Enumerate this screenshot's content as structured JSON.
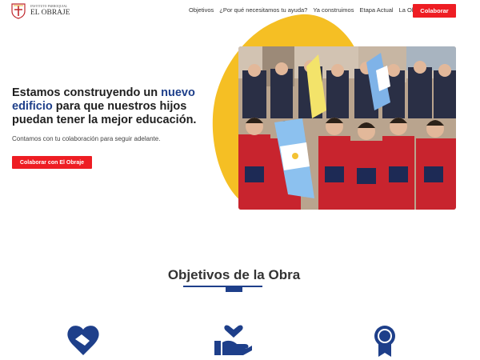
{
  "header": {
    "logo": {
      "small_text": "INSTITUTO PARROQUIAL",
      "big_text": "EL OBRAJE"
    },
    "nav": [
      "Objetivos",
      "¿Por qué necesitamos tu ayuda?",
      "Ya construimos",
      "Etapa Actual",
      "La Obra"
    ],
    "cta_label": "Colaborar"
  },
  "hero": {
    "title_part1": "Estamos construyendo un ",
    "title_highlight": "nuevo edificio",
    "title_part2": " para que nuestros hijos puedan tener la mejor educación.",
    "subtitle": "Contamos con tu colaboración para seguir adelante.",
    "cta_label": "Colaborar con El Obraje"
  },
  "section": {
    "title": "Objetivos de la Obra"
  },
  "icons": [
    "handshake-heart-icon",
    "hand-holding-heart-icon",
    "award-ribbon-icon"
  ],
  "colors": {
    "brand_red": "#ee1d23",
    "brand_navy": "#1e3f8a",
    "accent_yellow": "#f5bf24"
  }
}
